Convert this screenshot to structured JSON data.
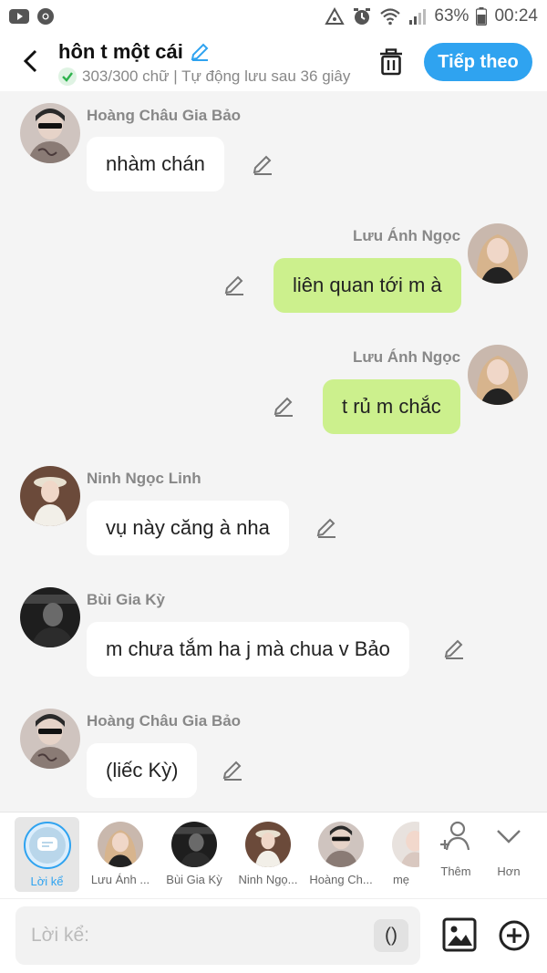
{
  "status_bar": {
    "battery": "63%",
    "time": "00:24",
    "left_icons": [
      "youtube-icon",
      "chrome-icon"
    ],
    "right_icons": [
      "data-saver-icon",
      "alarm-icon",
      "wifi-icon",
      "signal-icon",
      "battery-icon"
    ]
  },
  "header": {
    "title": "hôn t một cái",
    "subtitle": "303/300 chữ | Tự động lưu sau 36 giây",
    "next_label": "Tiếp theo",
    "accent": "#2fa3f0"
  },
  "messages": [
    {
      "side": "left",
      "name": "Hoàng Châu Gia Bảo",
      "text": "nhàm chán",
      "avatar": "avatar-bao"
    },
    {
      "side": "right",
      "name": "Lưu Ánh Ngọc",
      "text": "liên quan tới m à",
      "avatar": "avatar-ngoc"
    },
    {
      "side": "right",
      "name": "Lưu Ánh Ngọc",
      "text": "t rủ m chắc",
      "avatar": "avatar-ngoc"
    },
    {
      "side": "left",
      "name": "Ninh Ngọc Linh",
      "text": "vụ này căng à nha",
      "avatar": "avatar-linh"
    },
    {
      "side": "left",
      "name": "Bùi Gia Kỳ",
      "text": "m chưa tắm ha j mà chua v Bảo",
      "avatar": "avatar-ky"
    },
    {
      "side": "left",
      "name": "Hoàng Châu Gia Bảo",
      "text": "(liếc Kỳ)",
      "avatar": "avatar-bao"
    }
  ],
  "characters": {
    "narrator": "Lời kể",
    "list": [
      "Lưu Ánh ...",
      "Bùi Gia Kỳ",
      "Ninh Ngọ...",
      "Hoàng Ch...",
      "mẹ"
    ],
    "add_label": "Thêm",
    "more_label": "Hơn"
  },
  "input": {
    "placeholder": "Lời kể:",
    "paren_label": "()"
  },
  "colors": {
    "bubble_right": "#ccf08d",
    "bubble_left": "#ffffff",
    "background": "#f4f4f4"
  }
}
